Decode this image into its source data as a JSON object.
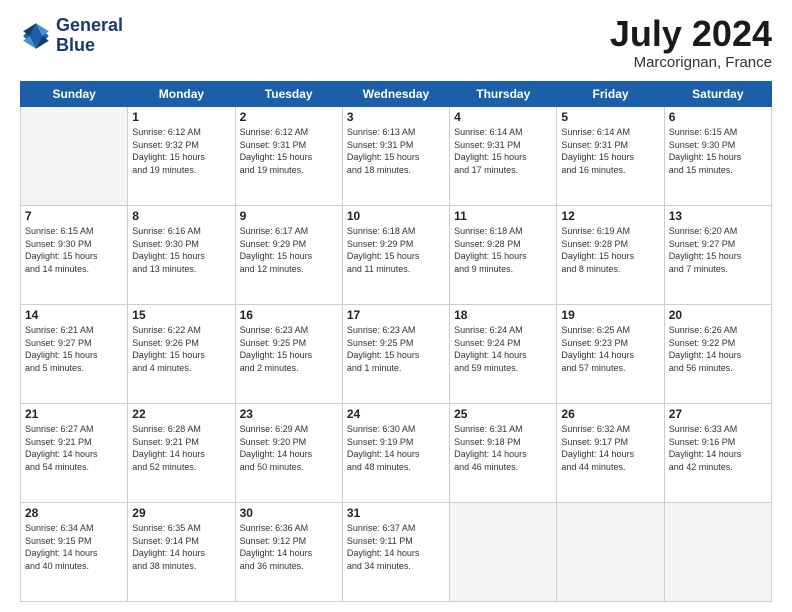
{
  "logo": {
    "line1": "General",
    "line2": "Blue"
  },
  "title": "July 2024",
  "location": "Marcorignan, France",
  "days": [
    "Sunday",
    "Monday",
    "Tuesday",
    "Wednesday",
    "Thursday",
    "Friday",
    "Saturday"
  ],
  "weeks": [
    [
      {
        "day": "",
        "text": ""
      },
      {
        "day": "1",
        "text": "Sunrise: 6:12 AM\nSunset: 9:32 PM\nDaylight: 15 hours\nand 19 minutes."
      },
      {
        "day": "2",
        "text": "Sunrise: 6:12 AM\nSunset: 9:31 PM\nDaylight: 15 hours\nand 19 minutes."
      },
      {
        "day": "3",
        "text": "Sunrise: 6:13 AM\nSunset: 9:31 PM\nDaylight: 15 hours\nand 18 minutes."
      },
      {
        "day": "4",
        "text": "Sunrise: 6:14 AM\nSunset: 9:31 PM\nDaylight: 15 hours\nand 17 minutes."
      },
      {
        "day": "5",
        "text": "Sunrise: 6:14 AM\nSunset: 9:31 PM\nDaylight: 15 hours\nand 16 minutes."
      },
      {
        "day": "6",
        "text": "Sunrise: 6:15 AM\nSunset: 9:30 PM\nDaylight: 15 hours\nand 15 minutes."
      }
    ],
    [
      {
        "day": "7",
        "text": "Sunrise: 6:15 AM\nSunset: 9:30 PM\nDaylight: 15 hours\nand 14 minutes."
      },
      {
        "day": "8",
        "text": "Sunrise: 6:16 AM\nSunset: 9:30 PM\nDaylight: 15 hours\nand 13 minutes."
      },
      {
        "day": "9",
        "text": "Sunrise: 6:17 AM\nSunset: 9:29 PM\nDaylight: 15 hours\nand 12 minutes."
      },
      {
        "day": "10",
        "text": "Sunrise: 6:18 AM\nSunset: 9:29 PM\nDaylight: 15 hours\nand 11 minutes."
      },
      {
        "day": "11",
        "text": "Sunrise: 6:18 AM\nSunset: 9:28 PM\nDaylight: 15 hours\nand 9 minutes."
      },
      {
        "day": "12",
        "text": "Sunrise: 6:19 AM\nSunset: 9:28 PM\nDaylight: 15 hours\nand 8 minutes."
      },
      {
        "day": "13",
        "text": "Sunrise: 6:20 AM\nSunset: 9:27 PM\nDaylight: 15 hours\nand 7 minutes."
      }
    ],
    [
      {
        "day": "14",
        "text": "Sunrise: 6:21 AM\nSunset: 9:27 PM\nDaylight: 15 hours\nand 5 minutes."
      },
      {
        "day": "15",
        "text": "Sunrise: 6:22 AM\nSunset: 9:26 PM\nDaylight: 15 hours\nand 4 minutes."
      },
      {
        "day": "16",
        "text": "Sunrise: 6:23 AM\nSunset: 9:25 PM\nDaylight: 15 hours\nand 2 minutes."
      },
      {
        "day": "17",
        "text": "Sunrise: 6:23 AM\nSunset: 9:25 PM\nDaylight: 15 hours\nand 1 minute."
      },
      {
        "day": "18",
        "text": "Sunrise: 6:24 AM\nSunset: 9:24 PM\nDaylight: 14 hours\nand 59 minutes."
      },
      {
        "day": "19",
        "text": "Sunrise: 6:25 AM\nSunset: 9:23 PM\nDaylight: 14 hours\nand 57 minutes."
      },
      {
        "day": "20",
        "text": "Sunrise: 6:26 AM\nSunset: 9:22 PM\nDaylight: 14 hours\nand 56 minutes."
      }
    ],
    [
      {
        "day": "21",
        "text": "Sunrise: 6:27 AM\nSunset: 9:21 PM\nDaylight: 14 hours\nand 54 minutes."
      },
      {
        "day": "22",
        "text": "Sunrise: 6:28 AM\nSunset: 9:21 PM\nDaylight: 14 hours\nand 52 minutes."
      },
      {
        "day": "23",
        "text": "Sunrise: 6:29 AM\nSunset: 9:20 PM\nDaylight: 14 hours\nand 50 minutes."
      },
      {
        "day": "24",
        "text": "Sunrise: 6:30 AM\nSunset: 9:19 PM\nDaylight: 14 hours\nand 48 minutes."
      },
      {
        "day": "25",
        "text": "Sunrise: 6:31 AM\nSunset: 9:18 PM\nDaylight: 14 hours\nand 46 minutes."
      },
      {
        "day": "26",
        "text": "Sunrise: 6:32 AM\nSunset: 9:17 PM\nDaylight: 14 hours\nand 44 minutes."
      },
      {
        "day": "27",
        "text": "Sunrise: 6:33 AM\nSunset: 9:16 PM\nDaylight: 14 hours\nand 42 minutes."
      }
    ],
    [
      {
        "day": "28",
        "text": "Sunrise: 6:34 AM\nSunset: 9:15 PM\nDaylight: 14 hours\nand 40 minutes."
      },
      {
        "day": "29",
        "text": "Sunrise: 6:35 AM\nSunset: 9:14 PM\nDaylight: 14 hours\nand 38 minutes."
      },
      {
        "day": "30",
        "text": "Sunrise: 6:36 AM\nSunset: 9:12 PM\nDaylight: 14 hours\nand 36 minutes."
      },
      {
        "day": "31",
        "text": "Sunrise: 6:37 AM\nSunset: 9:11 PM\nDaylight: 14 hours\nand 34 minutes."
      },
      {
        "day": "",
        "text": ""
      },
      {
        "day": "",
        "text": ""
      },
      {
        "day": "",
        "text": ""
      }
    ]
  ]
}
